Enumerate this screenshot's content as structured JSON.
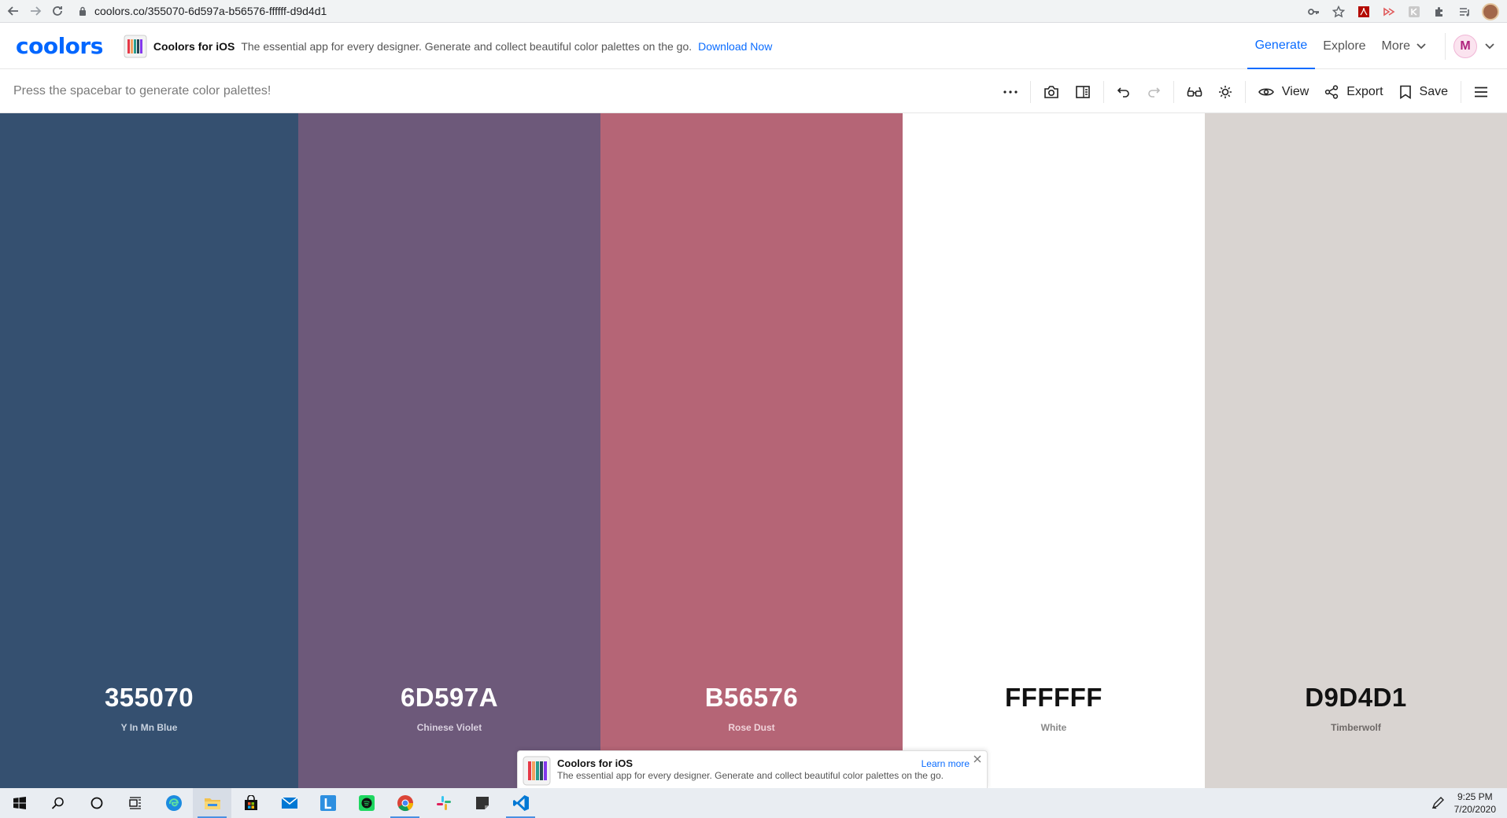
{
  "browser": {
    "url": "coolors.co/355070-6d597a-b56576-ffffff-d9d4d1"
  },
  "header": {
    "logo": "coolors",
    "promo": {
      "title": "Coolors for iOS",
      "description": "The essential app for every designer. Generate and collect beautiful color palettes on the go.",
      "link": "Download Now"
    },
    "nav": [
      {
        "label": "Generate",
        "active": true
      },
      {
        "label": "Explore"
      },
      {
        "label": "More"
      }
    ],
    "avatar_initial": "M"
  },
  "toolbar": {
    "hint": "Press the spacebar to generate color palettes!",
    "view_label": "View",
    "export_label": "Export",
    "save_label": "Save"
  },
  "palette": [
    {
      "hex": "355070",
      "name": "Y In Mn Blue",
      "color": "#355070",
      "text_color": "#ffffff",
      "name_color": "#c8d2df"
    },
    {
      "hex": "6D597A",
      "name": "Chinese Violet",
      "color": "#6d597a",
      "text_color": "#ffffff",
      "name_color": "#d9d0df"
    },
    {
      "hex": "B56576",
      "name": "Rose Dust",
      "color": "#b56576",
      "text_color": "#ffffff",
      "name_color": "#f0d3da"
    },
    {
      "hex": "FFFFFF",
      "name": "White",
      "color": "#ffffff",
      "text_color": "#111111",
      "name_color": "#888888"
    },
    {
      "hex": "D9D4D1",
      "name": "Timberwolf",
      "color": "#d9d4d1",
      "text_color": "#111111",
      "name_color": "#6f6a68"
    }
  ],
  "toast": {
    "title": "Coolors for iOS",
    "description": "The essential app for every designer. Generate and collect beautiful color palettes on the go.",
    "link": "Learn more"
  },
  "taskbar": {
    "time": "9:25 PM",
    "date": "7/20/2020"
  },
  "colors": {
    "accent": "#0a6cff"
  }
}
